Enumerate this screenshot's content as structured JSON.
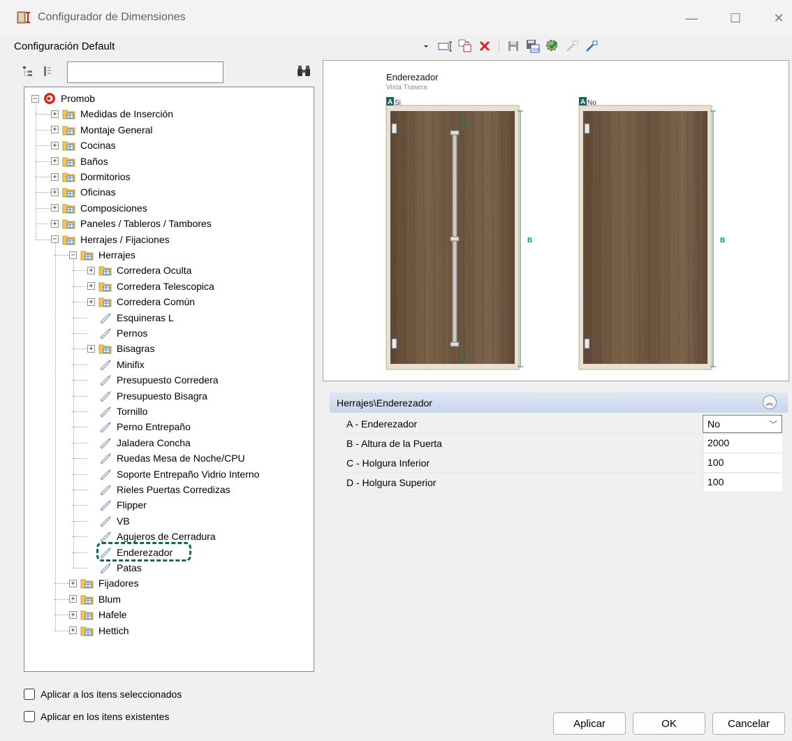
{
  "window": {
    "title": "Configurador de Dimensiones",
    "min": "—",
    "max": "☐",
    "close": "✕"
  },
  "config": {
    "name": "Configuración Default"
  },
  "search": {
    "value": "",
    "placeholder": ""
  },
  "tree": {
    "root": "Promob",
    "items": [
      {
        "label": "Medidas de Inserción",
        "type": "folder",
        "exp": "+"
      },
      {
        "label": "Montaje General",
        "type": "folder",
        "exp": "+"
      },
      {
        "label": "Cocinas",
        "type": "folder",
        "exp": "+"
      },
      {
        "label": "Baños",
        "type": "folder",
        "exp": "+"
      },
      {
        "label": "Dormitorios",
        "type": "folder",
        "exp": "+"
      },
      {
        "label": "Oficinas",
        "type": "folder",
        "exp": "+"
      },
      {
        "label": "Composiciones",
        "type": "folder",
        "exp": "+"
      },
      {
        "label": "Paneles / Tableros / Tambores",
        "type": "folder",
        "exp": "+"
      },
      {
        "label": "Herrajes / Fijaciones",
        "type": "folder",
        "exp": "−"
      },
      {
        "label": "Herrajes",
        "type": "folder",
        "exp": "−"
      },
      {
        "label": "Corredera Oculta",
        "type": "folder",
        "exp": "+"
      },
      {
        "label": "Corredera Telescopica",
        "type": "folder",
        "exp": "+"
      },
      {
        "label": "Corredera Común",
        "type": "folder",
        "exp": "+"
      },
      {
        "label": "Esquineras L",
        "type": "item"
      },
      {
        "label": "Pernos",
        "type": "item"
      },
      {
        "label": "Bisagras",
        "type": "folder",
        "exp": "+"
      },
      {
        "label": "Minifix",
        "type": "item"
      },
      {
        "label": "Presupuesto Corredera",
        "type": "item"
      },
      {
        "label": "Presupuesto Bisagra",
        "type": "item"
      },
      {
        "label": "Tornillo",
        "type": "item"
      },
      {
        "label": "Perno Entrepaño",
        "type": "item"
      },
      {
        "label": "Jaladera Concha",
        "type": "item"
      },
      {
        "label": "Ruedas Mesa de Noche/CPU",
        "type": "item"
      },
      {
        "label": "Soporte Entrepaño Vidrio Interno",
        "type": "item"
      },
      {
        "label": "Rieles Puertas Corredizas",
        "type": "item"
      },
      {
        "label": "Flipper",
        "type": "item"
      },
      {
        "label": "VB",
        "type": "item"
      },
      {
        "label": "Agujeros de Cerradura",
        "type": "item"
      },
      {
        "label": "Enderezador",
        "type": "item"
      },
      {
        "label": "Patas",
        "type": "item"
      },
      {
        "label": "Fijadores",
        "type": "folder",
        "exp": "+"
      },
      {
        "label": "Blum",
        "type": "folder",
        "exp": "+"
      },
      {
        "label": "Hafele",
        "type": "folder",
        "exp": "+"
      },
      {
        "label": "Hettich",
        "type": "folder",
        "exp": "+"
      }
    ]
  },
  "preview": {
    "title": "Enderezador",
    "subtitle": "Vista Trasera",
    "left_option": "Si",
    "right_option": "No",
    "marker": "A",
    "dim_b": "B",
    "dim_c": "C",
    "dim_d": "D"
  },
  "properties": {
    "header": "Herrajes\\Enderezador",
    "rows": [
      {
        "name": "A - Enderezador",
        "value": "No"
      },
      {
        "name": "B - Altura de la Puerta",
        "value": "2000"
      },
      {
        "name": "C - Holgura Inferior",
        "value": "100"
      },
      {
        "name": "D - Holgura Superior",
        "value": "100"
      }
    ]
  },
  "options": {
    "apply_selected": "Aplicar a los itens seleccionados",
    "apply_existing": "Aplicar en los itens existentes"
  },
  "buttons": {
    "apply": "Aplicar",
    "ok": "OK",
    "cancel": "Cancelar"
  },
  "colors": {
    "accent": "#13675a",
    "header_bg": "#c9d7ec",
    "wood": "#6b5440"
  }
}
